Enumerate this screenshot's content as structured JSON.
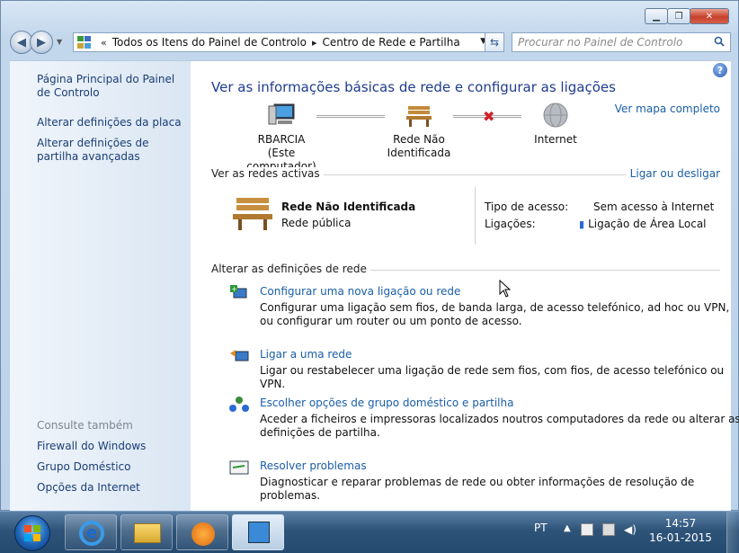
{
  "window": {
    "minimize_label": "▁",
    "maximize_label": "❐",
    "close_label": "✕"
  },
  "address": {
    "prefix": "«",
    "crumbs": [
      "Todos os Itens do Painel de Controlo",
      "Centro de Rede e Partilha"
    ],
    "separator": "▸",
    "search_placeholder": "Procurar no Painel de Controlo"
  },
  "sidebar": {
    "items": [
      {
        "label": "Página Principal do Painel de Controlo"
      },
      {
        "label": "Alterar definições da placa"
      },
      {
        "label": "Alterar definições de partilha avançadas"
      }
    ],
    "see_also_title": "Consulte também",
    "see_also": [
      {
        "label": "Firewall do Windows"
      },
      {
        "label": "Grupo Doméstico"
      },
      {
        "label": "Opções da Internet"
      }
    ]
  },
  "main": {
    "heading": "Ver as informações básicas de rede e configurar as ligações",
    "map_link": "Ver mapa completo",
    "nodes": [
      {
        "label": "RBARCIA",
        "sublabel": "(Este computador)"
      },
      {
        "label": "Rede Não Identificada"
      },
      {
        "label": "Internet"
      }
    ],
    "active_section": {
      "title": "Ver as redes activas",
      "action": "Ligar ou desligar",
      "network_name": "Rede Não Identificada",
      "network_type": "Rede pública",
      "access_label": "Tipo de acesso:",
      "access_value": "Sem acesso à Internet",
      "connections_label": "Ligações:",
      "connections_value": "Ligação de Área Local"
    },
    "change_section": {
      "title": "Alterar as definições de rede",
      "tasks": [
        {
          "title": "Configurar uma nova ligação ou rede",
          "desc": "Configurar uma ligação sem fios, de banda larga, de acesso telefónico, ad hoc ou VPN, ou configurar um router ou um ponto de acesso."
        },
        {
          "title": "Ligar a uma rede",
          "desc": "Ligar ou restabelecer uma ligação de rede sem fios, com fios, de acesso telefónico ou VPN."
        },
        {
          "title": "Escolher opções de grupo doméstico e partilha",
          "desc": "Aceder a ficheiros e impressoras localizados noutros computadores da rede ou alterar as definições de partilha."
        },
        {
          "title": "Resolver problemas",
          "desc": "Diagnosticar e reparar problemas de rede ou obter informações de resolução de problemas."
        }
      ]
    }
  },
  "taskbar": {
    "language": "PT",
    "time": "14:57",
    "date": "16-01-2015"
  }
}
